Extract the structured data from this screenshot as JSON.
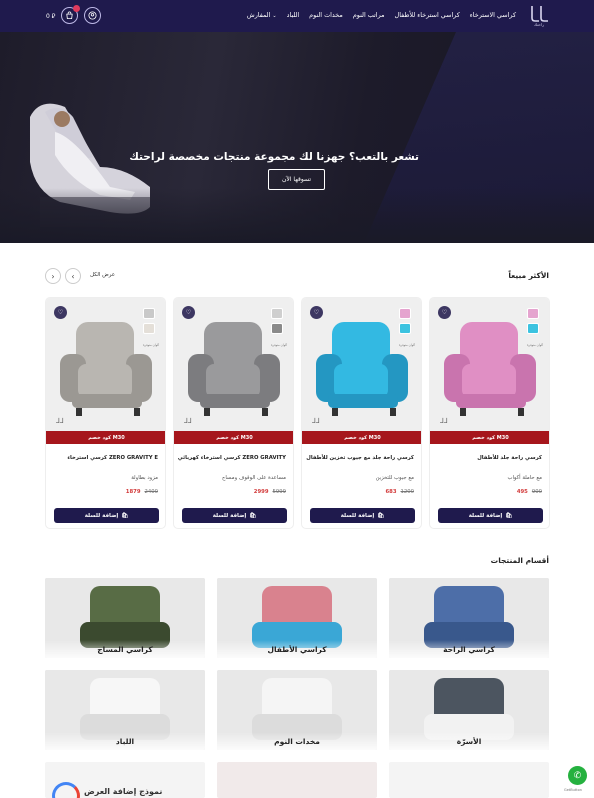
{
  "header": {
    "logo_text": "راحتك",
    "nav": [
      "كراسي الاسترخاء",
      "كراسي استرخاء للأطفال",
      "مراتب النوم",
      "مخدات النوم",
      "اللباد",
      "المفارش"
    ],
    "cart_total": "0 ⃁",
    "cart_count": "0"
  },
  "hero": {
    "title": "تشعر بالتعب؟ جهزنا لك مجموعة منتجات مخصصة لراحتك",
    "button": "تسوقها الآن"
  },
  "bestsellers": {
    "title": "الأكثر مبيعاً",
    "view_all": "عرض الكل",
    "prev": "‹",
    "next": "›",
    "products": [
      {
        "name": "كرسي راحة جلد للأطفال",
        "sub": "مع حاملة أكواب",
        "price_new": "495",
        "price_old": "900",
        "code": "كود خصم M30",
        "add": "إضافة للسلة",
        "swatches": [
          "#e5a4cf",
          "#3cc3e0"
        ],
        "swatch_label": "ألوان متوفرة",
        "colors": [
          "#e08fc4",
          "#c974ae"
        ]
      },
      {
        "name": "كرسي راحة جلد مع جيوب تخزين للأطفال",
        "sub": "مع جيوب للتخزين",
        "price_new": "683",
        "price_old": "1200",
        "code": "كود خصم M30",
        "add": "إضافة للسلة",
        "swatches": [
          "#e5a4cf",
          "#3cc3e0"
        ],
        "swatch_label": "ألوان متوفرة",
        "colors": [
          "#33b9e2",
          "#2497c2"
        ]
      },
      {
        "name": "كرسي استرخاء كهربائي ZERO GRAVITY",
        "sub": "مساعدة على الوقوف ومساج",
        "price_new": "2999",
        "price_old": "5999",
        "code": "كود خصم M30",
        "add": "إضافة للسلة",
        "swatches": [
          "#cfcfcf",
          "#8a8a8a"
        ],
        "swatch_label": "ألوان متوفرة",
        "colors": [
          "#9a9a9c",
          "#7c7c7f"
        ]
      },
      {
        "name": "كرسي استرخاء ZERO GRAVITY E",
        "sub": "مزود بطاولة",
        "price_new": "1879",
        "price_old": "2400",
        "code": "كود خصم M30",
        "add": "إضافة للسلة",
        "swatches": [
          "#c9c9c9",
          "#e4dfd8"
        ],
        "swatch_label": "ألوان متوفرة",
        "colors": [
          "#b9b6b1",
          "#9b9893"
        ]
      }
    ]
  },
  "categories": {
    "title": "أقسام المنتجات",
    "items": [
      {
        "label": "كراسي الراحة",
        "colors": [
          "#4d6ea8",
          "#39588c"
        ]
      },
      {
        "label": "كراسي الأطفال",
        "colors": [
          "#d9828e",
          "#3aa7d6"
        ]
      },
      {
        "label": "كراسي المساج",
        "colors": [
          "#586c45",
          "#3b4a2f"
        ]
      },
      {
        "label": "الأسرّة",
        "colors": [
          "#4c5560",
          "#f2f2f2"
        ]
      },
      {
        "label": "مخدات النوم",
        "colors": [
          "#f5f5f5",
          "#dcdcdc"
        ]
      },
      {
        "label": "اللباد",
        "colors": [
          "#f7f7f7",
          "#dcdcdc"
        ]
      }
    ]
  },
  "whatsapp_sub": "GetButton",
  "google_badge_text": "نموذج إضافة العرض"
}
